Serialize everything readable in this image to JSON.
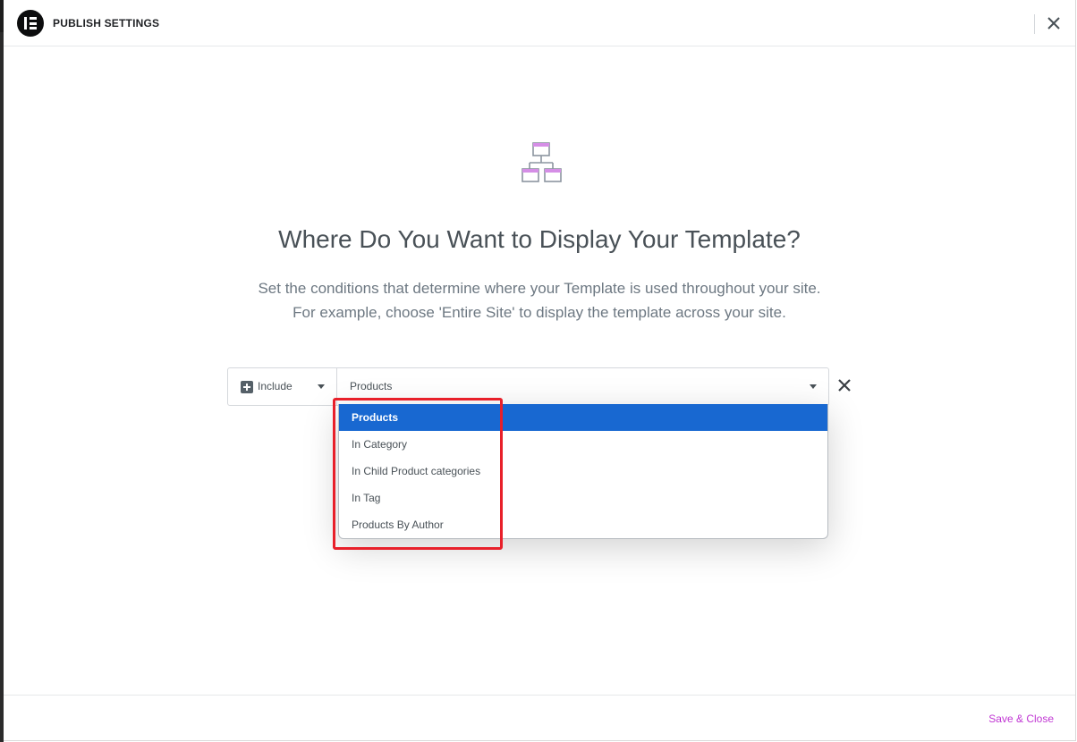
{
  "header": {
    "title": "PUBLISH SETTINGS",
    "logo_icon": "elementor-logo-icon",
    "close_icon": "close-icon"
  },
  "main": {
    "illustration_icon": "sitemap-icon",
    "title": "Where Do You Want to Display Your Template?",
    "description_line1": "Set the conditions that determine where your Template is used throughout your site.",
    "description_line2": "For example, choose 'Entire Site' to display the template across your site."
  },
  "condition": {
    "type_label": "Include",
    "type_icon": "plus-square-icon",
    "value_label": "Products",
    "remove_icon": "close-icon"
  },
  "dropdown": {
    "items": [
      {
        "label": "Products",
        "selected": true
      },
      {
        "label": "In Category",
        "selected": false
      },
      {
        "label": "In Child Product categories",
        "selected": false
      },
      {
        "label": "In Tag",
        "selected": false
      },
      {
        "label": "Products By Author",
        "selected": false
      }
    ]
  },
  "footer": {
    "save_label": "Save & Close"
  },
  "colors": {
    "accent": "#c036d3",
    "selected_item_bg": "#1868d1",
    "highlight_annotation": "#e8202a",
    "title_text": "#495157"
  }
}
